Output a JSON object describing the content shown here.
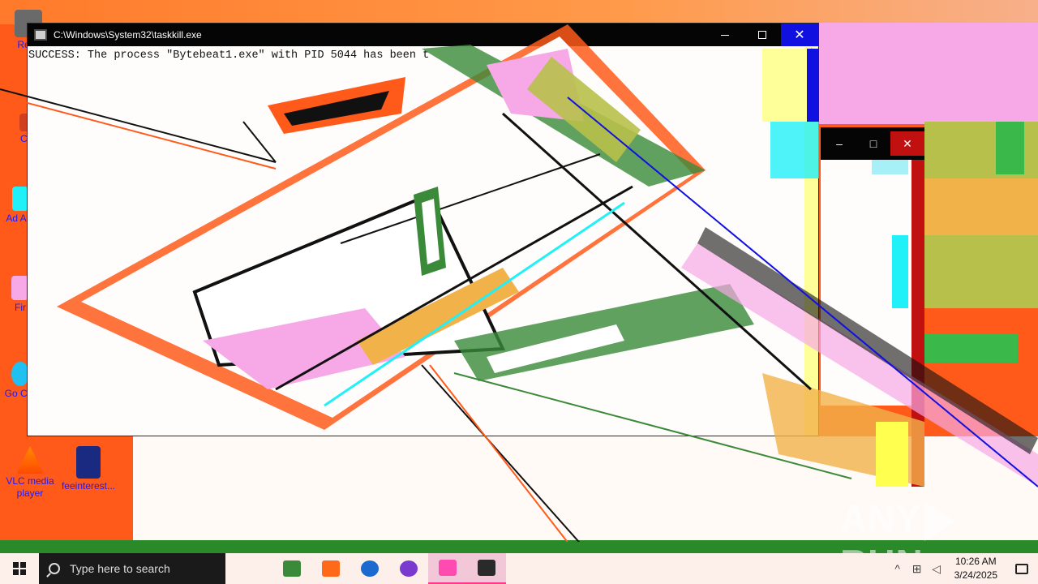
{
  "desktop": {
    "icons": [
      {
        "label": "Recy",
        "color": "#6a6a6a"
      },
      {
        "label": "CCl",
        "color": "#d04020"
      },
      {
        "label": "Ad Acr",
        "color": "#ff2a2a"
      },
      {
        "label": "Fir",
        "color": "#ff8a1a"
      },
      {
        "label": "Go Chr",
        "color": "#3ab84a"
      },
      {
        "label": "VLC media player",
        "color": "#ff8a00"
      },
      {
        "label": "feeinterest...",
        "color": "#1a2a80"
      }
    ]
  },
  "console": {
    "title": "C:\\Windows\\System32\\taskkill.exe",
    "line1": "SUCCESS: The process \"Bytebeat1.exe\" with PID 5044 has been t",
    "minimize_icon": "minimize-icon",
    "maximize_icon": "maximize-icon",
    "close_icon": "close-icon"
  },
  "window2": {
    "minimize": "–",
    "maximize": "□",
    "close": "✕"
  },
  "watermark": {
    "left": "ANY",
    "right": "RUN"
  },
  "taskbar": {
    "search_placeholder": "Type here to search",
    "apps": [
      {
        "name": "task-view",
        "color": "#3a8a3a"
      },
      {
        "name": "file-explorer",
        "color": "#ff6a1a"
      },
      {
        "name": "edge",
        "color": "#1a6ad0"
      },
      {
        "name": "firefox",
        "color": "#7a3ad0"
      },
      {
        "name": "chrome",
        "color": "#ff4ab0"
      },
      {
        "name": "console",
        "color": "#2a2a2a"
      }
    ],
    "clock_time": "10:26 AM",
    "clock_date": "3/24/2025"
  },
  "colors": {
    "desktop_orange": "#ff5a1a",
    "glitch_pink": "#f7a8e6",
    "glitch_green": "#3ab84a",
    "glitch_blue": "#1010e0",
    "glitch_cyan": "#20f0f8",
    "glitch_yellow": "#ffff50"
  }
}
